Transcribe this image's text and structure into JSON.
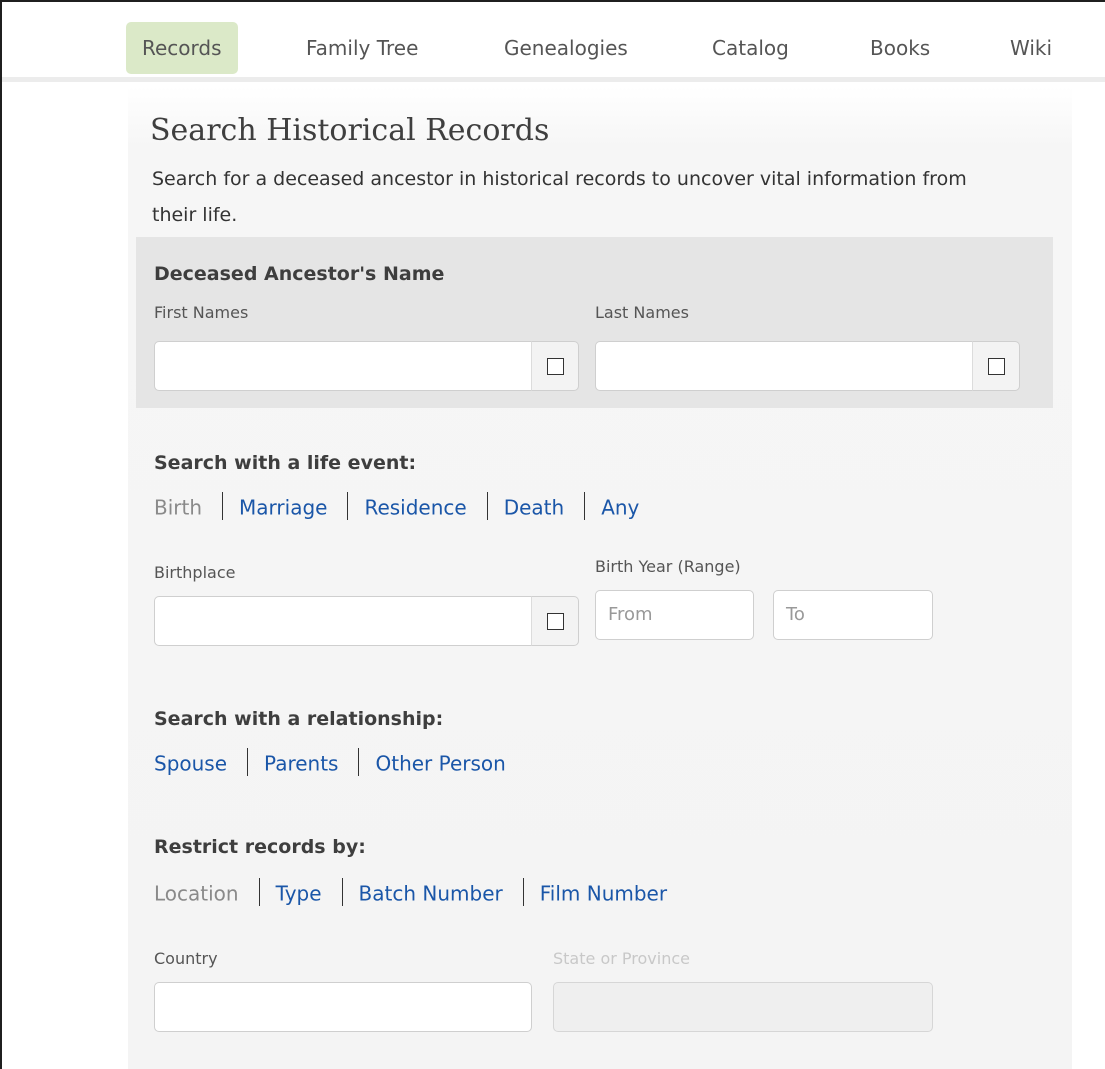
{
  "nav": {
    "items": [
      {
        "label": "Records",
        "active": true
      },
      {
        "label": "Family Tree"
      },
      {
        "label": "Genealogies"
      },
      {
        "label": "Catalog"
      },
      {
        "label": "Books"
      },
      {
        "label": "Wiki"
      }
    ]
  },
  "page": {
    "title": "Search Historical Records",
    "intro": "Search for a deceased ancestor in historical records to uncover vital information from their life."
  },
  "name_section": {
    "heading": "Deceased Ancestor's Name",
    "first_names_label": "First Names",
    "first_names_value": "",
    "last_names_label": "Last Names",
    "last_names_value": ""
  },
  "life_event": {
    "heading": "Search with a life event:",
    "tabs": [
      "Birth",
      "Marriage",
      "Residence",
      "Death",
      "Any"
    ],
    "selected": "Birth",
    "birthplace_label": "Birthplace",
    "birthplace_value": "",
    "birth_year_label": "Birth Year (Range)",
    "from_placeholder": "From",
    "to_placeholder": "To"
  },
  "relationship": {
    "heading": "Search with a relationship:",
    "tabs": [
      "Spouse",
      "Parents",
      "Other Person"
    ]
  },
  "restrict": {
    "heading": "Restrict records by:",
    "tabs": [
      "Location",
      "Type",
      "Batch Number",
      "Film Number"
    ],
    "selected": "Location",
    "country_label": "Country",
    "country_value": "",
    "state_label": "State or Province",
    "state_value": ""
  },
  "colors": {
    "link": "#1a56a8",
    "active_nav_bg": "#dbe9c8",
    "panel_bg": "#e5e5e5"
  }
}
